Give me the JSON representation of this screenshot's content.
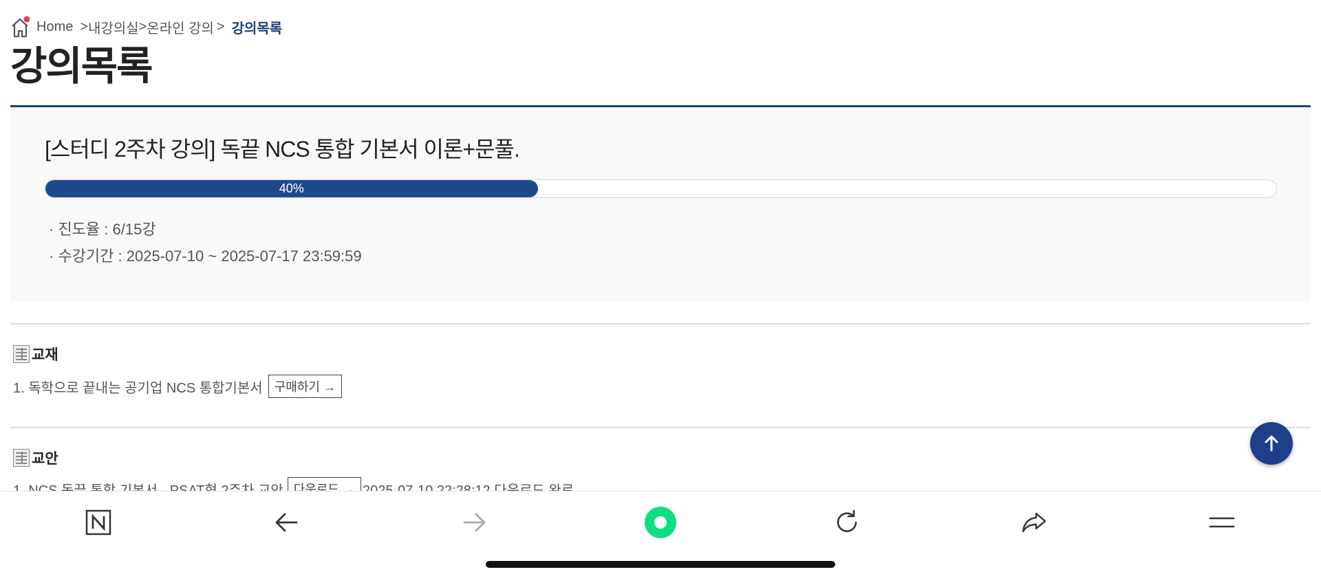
{
  "breadcrumb": {
    "home": "Home",
    "sep1": ">",
    "item1": "내강의실",
    "sep2": ">",
    "item2": "온라인 강의",
    "sep3": ">",
    "current": "강의목록"
  },
  "page_title": "강의목록",
  "course": {
    "name": "[스터디 2주차 강의] 독끝 NCS 통합 기본서 이론+문풀.",
    "progress_percent": 40,
    "progress_label": "40%",
    "progress_text": "· 진도율 : 6/15강",
    "period_text": "· 수강기간 : 2025-07-10 ~ 2025-07-17 23:59:59"
  },
  "textbook": {
    "heading": "교재",
    "items": [
      {
        "text": "1. 독학으로 끝내는 공기업 NCS 통합기본서",
        "button": "구매하기 →"
      }
    ]
  },
  "lesson_plan": {
    "heading": "교안",
    "items": [
      {
        "text": "1. NCS 독끝 통합 기본서 - PSAT형 2주차 교안",
        "button": "다운로드 →",
        "status": "2025-07-10 22:28:12 다운로드 완료"
      }
    ]
  },
  "icons": {
    "home": "home-icon",
    "scroll_top": "arrow-up-icon",
    "toolbar": [
      "naver-n-icon",
      "back-arrow-icon",
      "forward-arrow-icon",
      "green-circle-icon",
      "refresh-icon",
      "share-icon",
      "menu-icon"
    ]
  },
  "colors": {
    "accent": "#1e3f7a",
    "progress_fill": "#1e4a8c",
    "green": "#0dde7e"
  }
}
